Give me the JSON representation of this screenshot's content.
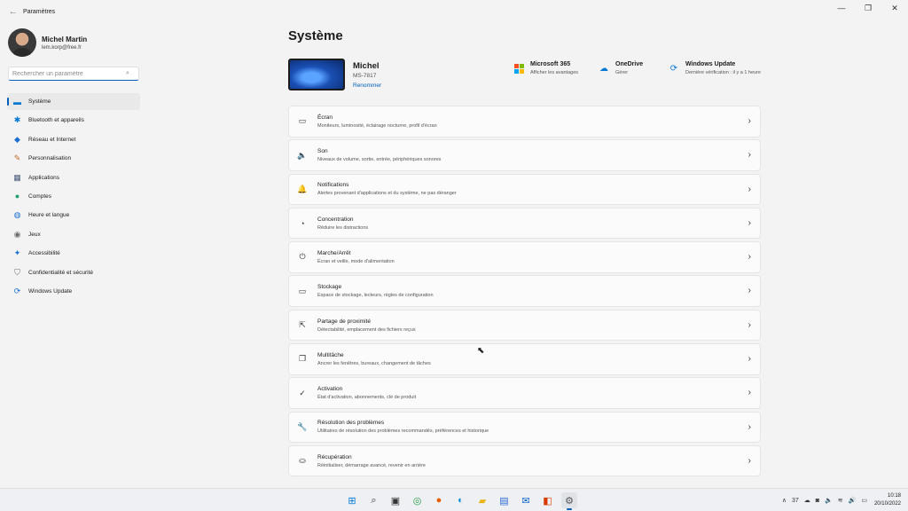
{
  "window": {
    "title": "Paramètres",
    "back_icon": "back-arrow-icon",
    "minimize": "—",
    "maximize": "❐",
    "close": "✕"
  },
  "profile": {
    "name": "Michel Martin",
    "email": "lem.korp@free.fr"
  },
  "search": {
    "placeholder": "Rechercher un paramètre"
  },
  "nav": [
    {
      "label": "Système",
      "icon": "monitor-icon",
      "glyph": "▬",
      "color": "#0078d4"
    },
    {
      "label": "Bluetooth et appareils",
      "icon": "bluetooth-icon",
      "glyph": "✱",
      "color": "#0078d4"
    },
    {
      "label": "Réseau et Internet",
      "icon": "wifi-icon",
      "glyph": "◆",
      "color": "#1a6fd1"
    },
    {
      "label": "Personnalisation",
      "icon": "brush-icon",
      "glyph": "✎",
      "color": "#c46b2b"
    },
    {
      "label": "Applications",
      "icon": "apps-icon",
      "glyph": "▦",
      "color": "#4a5d7a"
    },
    {
      "label": "Comptes",
      "icon": "account-icon",
      "glyph": "●",
      "color": "#1f9e6b"
    },
    {
      "label": "Heure et langue",
      "icon": "globe-clock-icon",
      "glyph": "◍",
      "color": "#1a6fd1"
    },
    {
      "label": "Jeux",
      "icon": "gamepad-icon",
      "glyph": "◉",
      "color": "#6b6b6b"
    },
    {
      "label": "Accessibilité",
      "icon": "accessibility-icon",
      "glyph": "✦",
      "color": "#1a6fd1"
    },
    {
      "label": "Confidentialité et sécurité",
      "icon": "shield-icon",
      "glyph": "⛉",
      "color": "#6b6b6b"
    },
    {
      "label": "Windows Update",
      "icon": "windows-update-icon",
      "glyph": "⟳",
      "color": "#1a6fd1"
    }
  ],
  "page_title": "Système",
  "device": {
    "name": "Michel",
    "model": "MS-7817",
    "rename": "Renommer"
  },
  "quick": [
    {
      "title": "Microsoft 365",
      "sub": "Afficher les avantages",
      "icon": "microsoft365-icon"
    },
    {
      "title": "OneDrive",
      "sub": "Gérer",
      "icon": "onedrive-icon"
    },
    {
      "title": "Windows Update",
      "sub": "Dernière vérification : il y a 1 heure",
      "icon": "windows-update-icon"
    }
  ],
  "cards": [
    {
      "title": "Écran",
      "sub": "Moniteurs, luminosité, éclairage nocturne, profil d'écran",
      "icon": "display-icon",
      "glyph": "▭"
    },
    {
      "title": "Son",
      "sub": "Niveaux de volume, sortie, entrée, périphériques sonores",
      "icon": "speaker-icon",
      "glyph": "🔈"
    },
    {
      "title": "Notifications",
      "sub": "Alertes provenant d'applications et du système, ne pas déranger",
      "icon": "bell-icon",
      "glyph": "🔔"
    },
    {
      "title": "Concentration",
      "sub": "Réduire les distractions",
      "icon": "focus-icon",
      "glyph": "◔"
    },
    {
      "title": "Marche/Arrêt",
      "sub": "Écran et veille, mode d'alimentation",
      "icon": "power-icon",
      "glyph": "⏻"
    },
    {
      "title": "Stockage",
      "sub": "Espace de stockage, lecteurs, règles de configuration",
      "icon": "storage-icon",
      "glyph": "▭"
    },
    {
      "title": "Partage de proximité",
      "sub": "Détectabilité, emplacement des fichiers reçus",
      "icon": "share-icon",
      "glyph": "⇱"
    },
    {
      "title": "Multitâche",
      "sub": "Ancrer les fenêtres, bureaux, changement de tâches",
      "icon": "multitask-icon",
      "glyph": "❐"
    },
    {
      "title": "Activation",
      "sub": "État d'activation, abonnements, clé de produit",
      "icon": "activation-icon",
      "glyph": "✓"
    },
    {
      "title": "Résolution des problèmes",
      "sub": "Utilitaires de résolution des problèmes recommandés, préférences et historique",
      "icon": "wrench-icon",
      "glyph": "🔧"
    },
    {
      "title": "Récupération",
      "sub": "Réinitialiser, démarrage avancé, revenir en arrière",
      "icon": "recovery-icon",
      "glyph": "⛀"
    }
  ],
  "chevron": "›",
  "taskbar": [
    {
      "icon": "start-icon",
      "glyph": "⊞",
      "color": "#0078d4"
    },
    {
      "icon": "search-icon",
      "glyph": "⌕",
      "color": "#333333"
    },
    {
      "icon": "task-view-icon",
      "glyph": "▣",
      "color": "#333333"
    },
    {
      "icon": "chrome-icon",
      "glyph": "◎",
      "color": "#2a9d4b"
    },
    {
      "icon": "firefox-icon",
      "glyph": "●",
      "color": "#e66000"
    },
    {
      "icon": "edge-icon",
      "glyph": "◐",
      "color": "#0a8bd6"
    },
    {
      "icon": "file-explorer-icon",
      "glyph": "▰",
      "color": "#e9b419"
    },
    {
      "icon": "store-icon",
      "glyph": "▤",
      "color": "#2a6ad1"
    },
    {
      "icon": "outlook-icon",
      "glyph": "✉",
      "color": "#0a64c9"
    },
    {
      "icon": "office-icon",
      "glyph": "◧",
      "color": "#d83b01"
    },
    {
      "icon": "settings-icon",
      "glyph": "⚙",
      "color": "#555555"
    }
  ],
  "tray": {
    "chevron": "∧",
    "weather": "37",
    "clock_time": "10:18",
    "clock_date": "20/10/2022"
  }
}
